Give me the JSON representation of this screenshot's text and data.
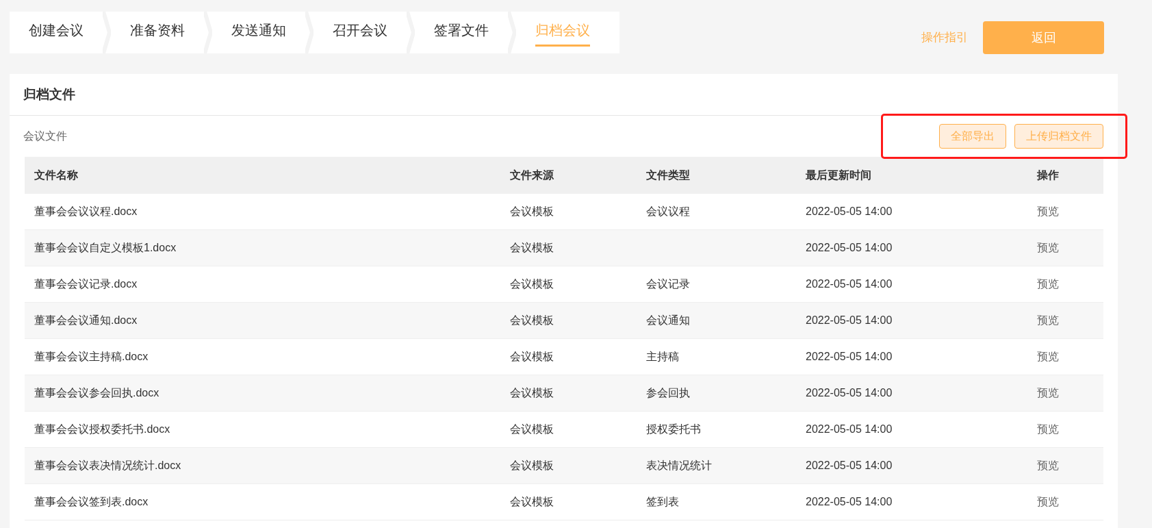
{
  "steps": [
    {
      "label": "创建会议",
      "selected": false
    },
    {
      "label": "准备资料",
      "selected": false
    },
    {
      "label": "发送通知",
      "selected": false
    },
    {
      "label": "召开会议",
      "selected": false
    },
    {
      "label": "签署文件",
      "selected": false
    },
    {
      "label": "归档会议",
      "selected": true
    }
  ],
  "header_actions": {
    "guide_link": "操作指引",
    "back_button": "返回"
  },
  "card": {
    "title": "归档文件",
    "section_label": "会议文件",
    "buttons": [
      "全部导出",
      "上传归档文件"
    ]
  },
  "table": {
    "columns": [
      "文件名称",
      "文件来源",
      "文件类型",
      "最后更新时间",
      "操作"
    ],
    "rows": [
      [
        "董事会会议议程.docx",
        "会议模板",
        "会议议程",
        "2022-05-05 14:00",
        "预览"
      ],
      [
        "董事会会议自定义模板1.docx",
        "会议模板",
        "",
        "2022-05-05 14:00",
        "预览"
      ],
      [
        "董事会会议记录.docx",
        "会议模板",
        "会议记录",
        "2022-05-05 14:00",
        "预览"
      ],
      [
        "董事会会议通知.docx",
        "会议模板",
        "会议通知",
        "2022-05-05 14:00",
        "预览"
      ],
      [
        "董事会会议主持稿.docx",
        "会议模板",
        "主持稿",
        "2022-05-05 14:00",
        "预览"
      ],
      [
        "董事会会议参会回执.docx",
        "会议模板",
        "参会回执",
        "2022-05-05 14:00",
        "预览"
      ],
      [
        "董事会会议授权委托书.docx",
        "会议模板",
        "授权委托书",
        "2022-05-05 14:00",
        "预览"
      ],
      [
        "董事会会议表决情况统计.docx",
        "会议模板",
        "表决情况统计",
        "2022-05-05 14:00",
        "预览"
      ],
      [
        "董事会会议签到表.docx",
        "会议模板",
        "签到表",
        "2022-05-05 14:00",
        "预览"
      ]
    ]
  }
}
